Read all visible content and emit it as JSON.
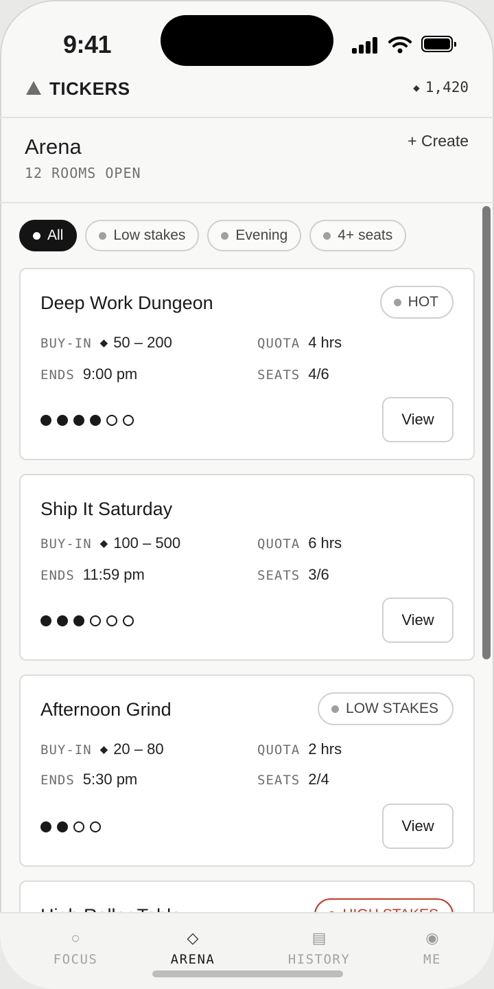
{
  "status_bar": {
    "time": "9:41"
  },
  "app": {
    "logo_text": "TICKERS",
    "balance_icon": "◆",
    "balance": "1,420"
  },
  "page": {
    "title": "Arena",
    "subtitle": "12 ROOMS OPEN",
    "create_label": "+ Create"
  },
  "filters": [
    {
      "label": "All",
      "active": true
    },
    {
      "label": "Low stakes",
      "active": false
    },
    {
      "label": "Evening",
      "active": false
    },
    {
      "label": "4+ seats",
      "active": false
    }
  ],
  "labels": {
    "buy_in": "BUY-IN",
    "quota": "QUOTA",
    "ends": "ENDS",
    "seats": "SEATS",
    "view": "View",
    "diamond": "◆"
  },
  "rooms": [
    {
      "name": "Deep Work Dungeon",
      "badge": "HOT",
      "buy_in": "50 – 200",
      "quota": "4 hrs",
      "ends": "9:00 pm",
      "seats": "4/6",
      "seats_filled": 4,
      "seats_total": 6
    },
    {
      "name": "Ship It Saturday",
      "badge": "",
      "buy_in": "100 – 500",
      "quota": "6 hrs",
      "ends": "11:59 pm",
      "seats": "3/6",
      "seats_filled": 3,
      "seats_total": 6
    },
    {
      "name": "Afternoon Grind",
      "badge": "LOW STAKES",
      "buy_in": "20 – 80",
      "quota": "2 hrs",
      "ends": "5:30 pm",
      "seats": "2/4",
      "seats_filled": 2,
      "seats_total": 4
    },
    {
      "name": "High Roller Table",
      "badge": "HIGH STAKES"
    }
  ],
  "tabbar": [
    {
      "label": "FOCUS",
      "icon": "circle-icon",
      "glyph": "○",
      "active": false
    },
    {
      "label": "ARENA",
      "icon": "diamond-icon",
      "glyph": "◇",
      "active": true
    },
    {
      "label": "HISTORY",
      "icon": "list-icon",
      "glyph": "▤",
      "active": false
    },
    {
      "label": "ME",
      "icon": "profile-icon",
      "glyph": "◉",
      "active": false
    }
  ],
  "colors": {
    "accent": "#141414",
    "danger": "#c0392b",
    "muted": "#a0a0a0"
  }
}
